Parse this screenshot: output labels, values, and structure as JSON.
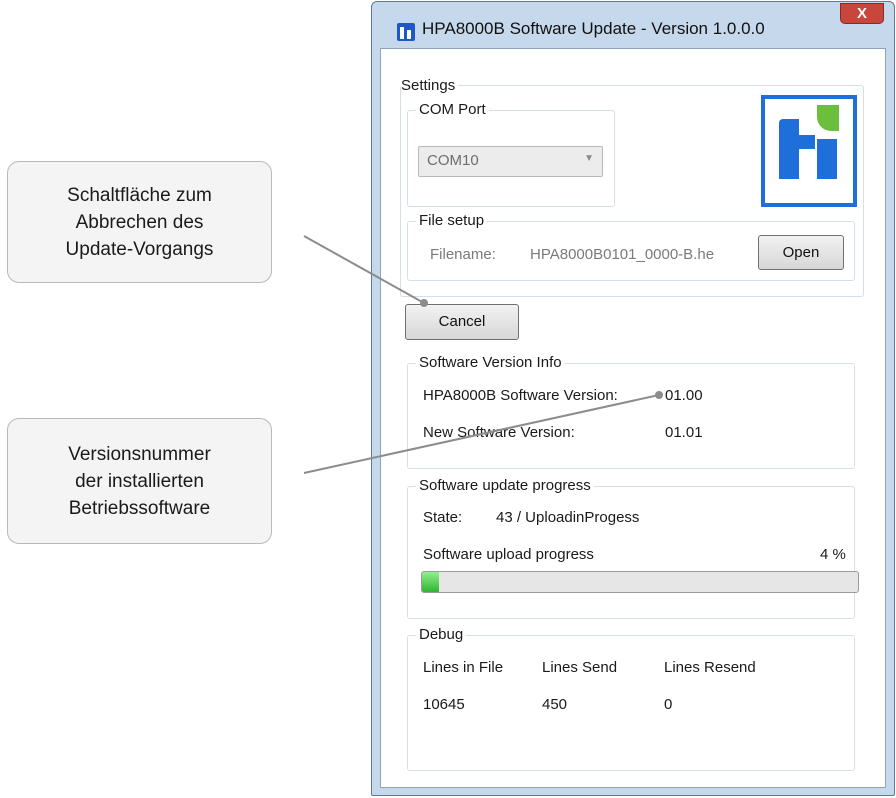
{
  "callouts": {
    "cancel": [
      "Schaltfläche zum",
      "Abbrechen des",
      "Update-Vorgangs"
    ],
    "version": [
      "Versionsnummer",
      "der installierten",
      "Betriebssoftware"
    ]
  },
  "window": {
    "title": "HPA8000B Software Update - Version 1.0.0.0",
    "close_glyph": "X"
  },
  "settings": {
    "title": "Settings",
    "com_port": {
      "title": "COM Port",
      "selected": "COM10"
    },
    "file_setup": {
      "title": "File setup",
      "filename_label": "Filename:",
      "filename_value": "HPA8000B0101_0000-B.he",
      "open_label": "Open"
    }
  },
  "cancel_label": "Cancel",
  "version_info": {
    "title": "Software Version Info",
    "installed_label": "HPA8000B Software Version:",
    "installed_value": "01.00",
    "new_label": "New Software Version:",
    "new_value": "01.01"
  },
  "update_progress": {
    "title": "Software update progress",
    "state_label": "State:",
    "state_value": "43 / UploadinProgess",
    "upload_label": "Software upload progress",
    "percent_text": "4 %",
    "progress_fraction": 0.04
  },
  "debug": {
    "title": "Debug",
    "headers": [
      "Lines in File",
      "Lines Send",
      "Lines Resend"
    ],
    "values": [
      "10645",
      "450",
      "0"
    ]
  },
  "colors": {
    "accent": "#1e6fd9",
    "logo_green": "#6cbf3c",
    "progress_green": "#2fb52f"
  }
}
